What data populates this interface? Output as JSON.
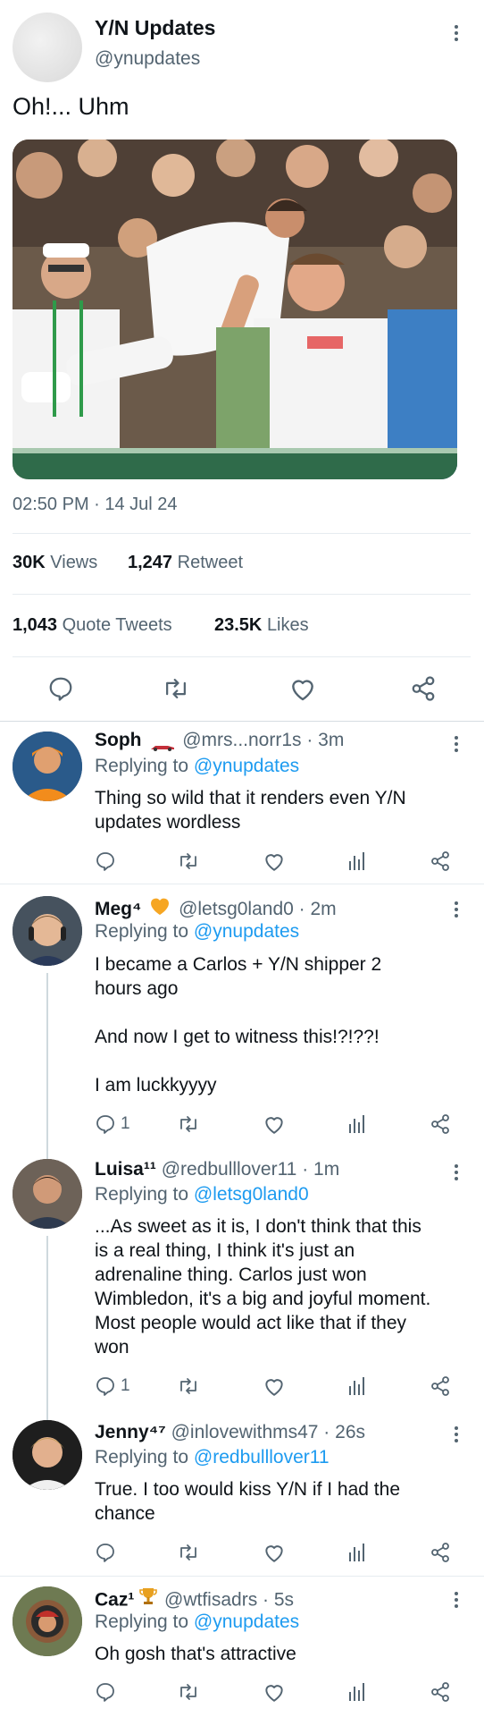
{
  "main_tweet": {
    "display_name": "Y/N Updates",
    "handle": "@ynupdates",
    "text": "Oh!... Uhm",
    "timestamp": "02:50 PM · 14 Jul 24",
    "views_count": "30K",
    "views_label": "Views",
    "retweet_count": "1,247",
    "retweet_label": "Retweet",
    "quote_count": "1,043",
    "quote_label": "Quote Tweets",
    "likes_count": "23.5K",
    "likes_label": "Likes"
  },
  "replies": [
    {
      "name": "Soph",
      "handle": "@mrs...norr1s · 3m",
      "replying_label": "Replying to",
      "replying_to": "@ynupdates",
      "text_lines": [
        "Thing so wild that it renders even Y/N",
        "updates wordless"
      ],
      "reply_count": ""
    },
    {
      "name": "Meg⁴",
      "handle": "@letsg0land0 · 2m",
      "replying_label": "Replying to",
      "replying_to": "@ynupdates",
      "text_lines": [
        "I became a Carlos + Y/N shipper 2",
        "hours ago",
        "",
        "And now I get to witness this!?!??!",
        "",
        "I am luckkyyyy"
      ],
      "reply_count": "1"
    },
    {
      "name": "Luisa¹¹",
      "handle": "@redbulllover11 · 1m",
      "replying_label": "Replying to",
      "replying_to": "@letsg0land0",
      "text_lines": [
        "...As sweet as it is, I don't think that this",
        "is a real thing, I think it's just an",
        "adrenaline thing. Carlos just won",
        "Wimbledon, it's a big and joyful moment.",
        "Most people would act like that if they",
        "won"
      ],
      "reply_count": "1"
    },
    {
      "name": "Jenny⁴⁷",
      "handle": "@inlovewithms47 · 26s",
      "replying_label": "Replying to",
      "replying_to": "@redbulllover11",
      "text_lines": [
        "True. I too would kiss Y/N if I had the",
        "chance"
      ],
      "reply_count": ""
    },
    {
      "name": "Caz¹",
      "handle": "@wtfisadrs · 5s",
      "replying_label": "Replying to",
      "replying_to": "@ynupdates",
      "text_lines": [
        "Oh gosh that's attractive"
      ],
      "reply_count": ""
    }
  ],
  "colors": {
    "accent_blue": "#1d9bf0",
    "text_gray": "#536471",
    "divider": "#e6ecf0"
  }
}
